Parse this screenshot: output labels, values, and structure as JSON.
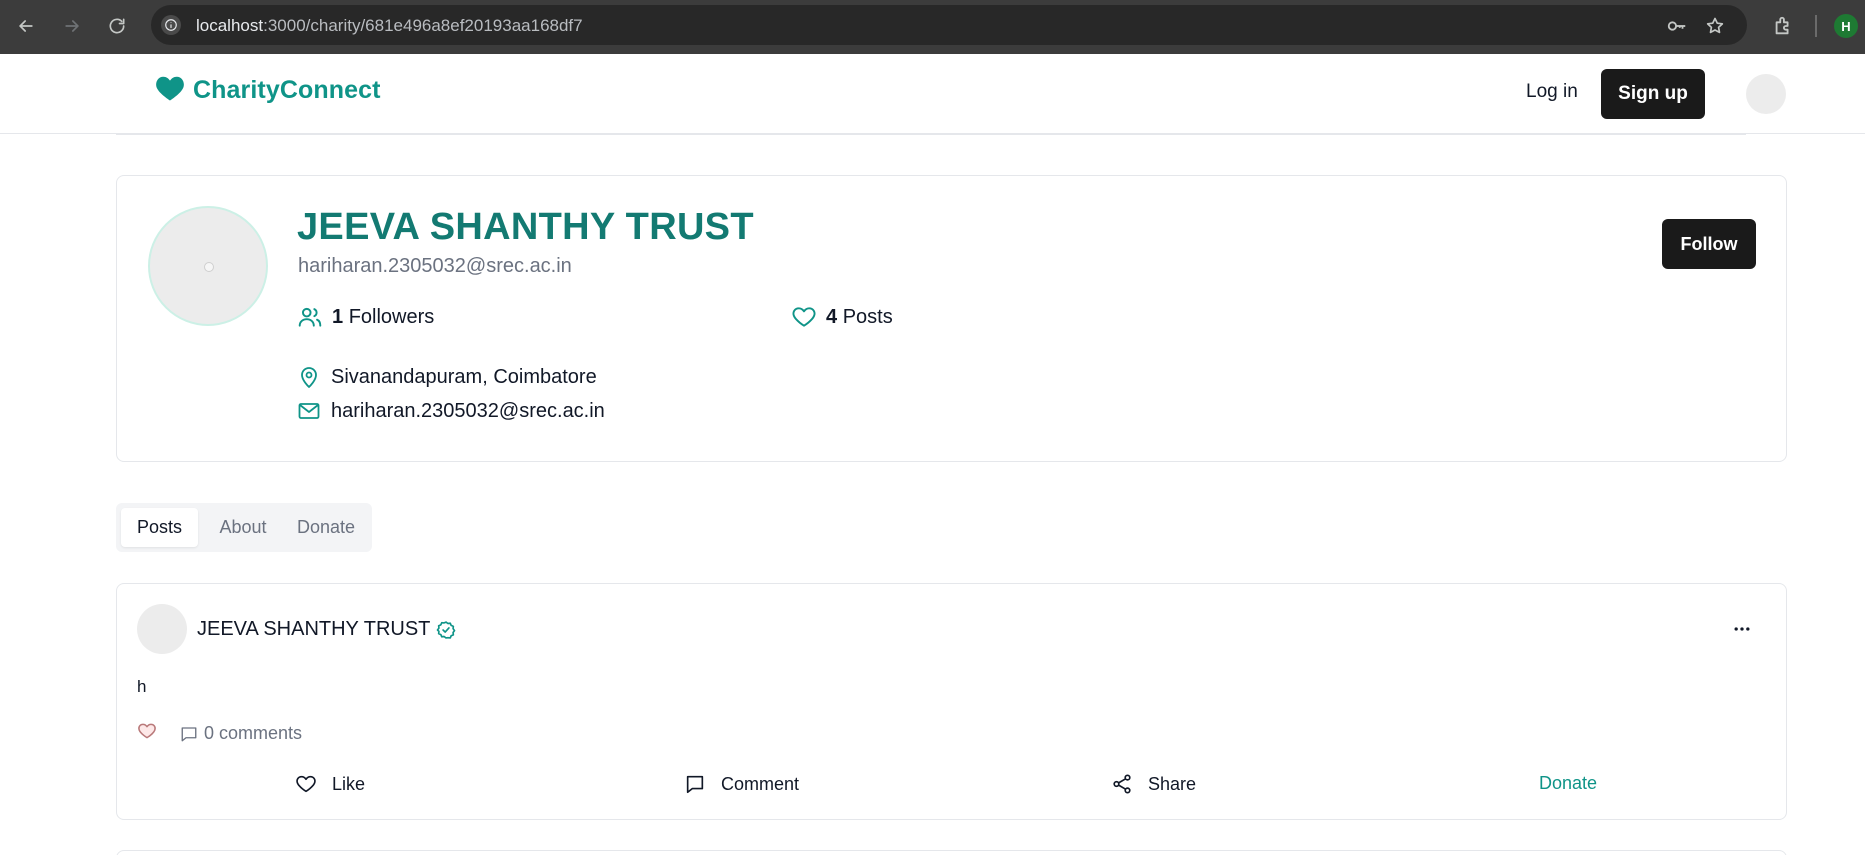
{
  "browser": {
    "url_host": "localhost",
    "url_path": ":3000/charity/681e496a8ef20193aa168df7",
    "profile_initial": "H"
  },
  "header": {
    "brand": "CharityConnect",
    "login_label": "Log in",
    "signup_label": "Sign up"
  },
  "profile": {
    "name": "JEEVA SHANTHY TRUST",
    "email": "hariharan.2305032@srec.ac.in",
    "followers_count": "1",
    "followers_label": "Followers",
    "posts_count": "4",
    "posts_label": "Posts",
    "location": "Sivanandapuram, Coimbatore",
    "contact_email": "hariharan.2305032@srec.ac.in",
    "follow_label": "Follow"
  },
  "tabs": [
    {
      "label": "Posts",
      "active": true
    },
    {
      "label": "About",
      "active": false
    },
    {
      "label": "Donate",
      "active": false
    }
  ],
  "post": {
    "author": "JEEVA SHANTHY TRUST",
    "text": "h",
    "comments_label": "0 comments",
    "actions": {
      "like": "Like",
      "comment": "Comment",
      "share": "Share",
      "donate": "Donate"
    }
  },
  "colors": {
    "brand": "#0f9488",
    "title": "#137a72",
    "dark_button": "#1a1a1a"
  }
}
